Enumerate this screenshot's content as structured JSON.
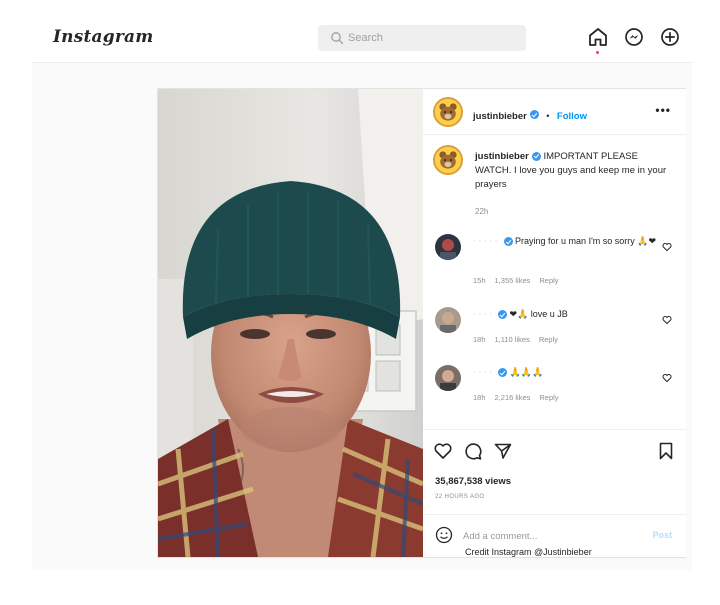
{
  "nav": {
    "logo": "Instagram",
    "search_placeholder": "Search",
    "icons": [
      "home-icon",
      "messenger-icon",
      "new-post-icon"
    ]
  },
  "post": {
    "author": "justinbieber",
    "separator": "•",
    "follow_label": "Follow",
    "more_label": "•••",
    "caption": "IMPORTANT PLEASE WATCH. I love you guys and keep me in your prayers",
    "caption_time": "22h",
    "comments": [
      {
        "user": "· · · · ·",
        "text": "Praying for u man I'm so sorry 🙏❤",
        "time": "15h",
        "likes": "1,355 likes",
        "reply": "Reply"
      },
      {
        "user": "· · · ·",
        "text": "❤🙏 love u JB",
        "time": "18h",
        "likes": "1,110 likes",
        "reply": "Reply"
      },
      {
        "user": "· · · ·",
        "text": "🙏🙏🙏",
        "time": "18h",
        "likes": "2,216 likes",
        "reply": "Reply"
      }
    ],
    "views": "35,867,538 views",
    "posted": "22 HOURS AGO",
    "comment_placeholder": "Add a comment...",
    "post_label": "Post"
  },
  "credit": "Credit Instagram @Justinbieber",
  "colors": {
    "accent": "#0095f6",
    "verified": "#3897f0",
    "like_red": "#ed4956"
  }
}
